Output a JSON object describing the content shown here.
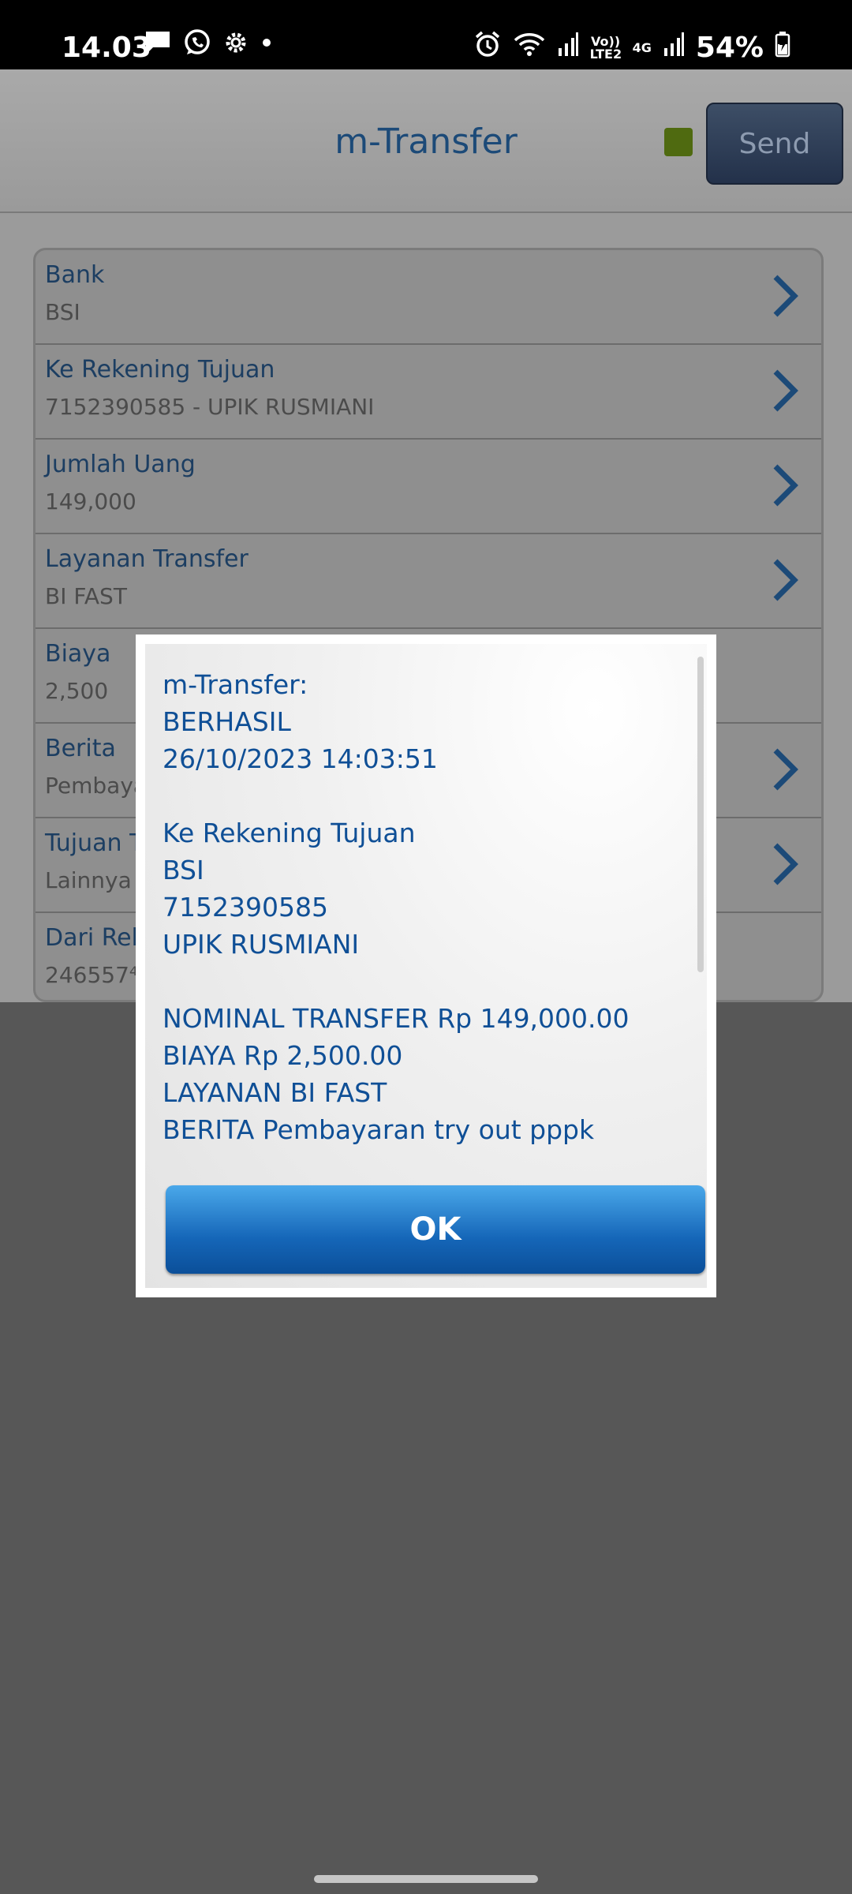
{
  "status_bar": {
    "time": "14.03",
    "battery": "54%",
    "volte_label": "Vo)) LTE2",
    "net_label": "4G",
    "icons": [
      "message-icon",
      "whatsapp-icon",
      "settings-icon",
      "dot-icon",
      "alarm-icon",
      "wifi-icon",
      "signal-icon",
      "signal-icon",
      "battery-icon"
    ]
  },
  "header": {
    "title": "m-Transfer",
    "send_label": "Send",
    "status_color": "#4f6a10"
  },
  "form": {
    "items": [
      {
        "label": "Bank",
        "value": "BSI"
      },
      {
        "label": "Ke Rekening Tujuan",
        "value": "7152390585 - UPIK RUSMIANI"
      },
      {
        "label": "Jumlah Uang",
        "value": "149,000"
      },
      {
        "label": "Layanan Transfer",
        "value": "BI FAST"
      },
      {
        "label": "Biaya",
        "value": "2,500"
      },
      {
        "label": "Berita",
        "value": "Pembaya"
      },
      {
        "label": "Tujuan T",
        "value": "Lainnya"
      },
      {
        "label": "Dari Rek",
        "value": "246557⁴"
      }
    ]
  },
  "dialog": {
    "lines": [
      "m-Transfer:",
      "BERHASIL",
      "26/10/2023 14:03:51",
      "",
      "Ke Rekening Tujuan",
      "BSI",
      "7152390585",
      "UPIK RUSMIANI",
      "",
      "NOMINAL TRANSFER Rp 149,000.00",
      "BIAYA Rp 2,500.00",
      "LAYANAN BI FAST",
      "BERITA Pembayaran try out pppk"
    ],
    "ok_label": "OK"
  },
  "colors": {
    "accent": "#1566b8",
    "title_blue": "#1c4a78",
    "text_blue": "#0f4f96"
  }
}
